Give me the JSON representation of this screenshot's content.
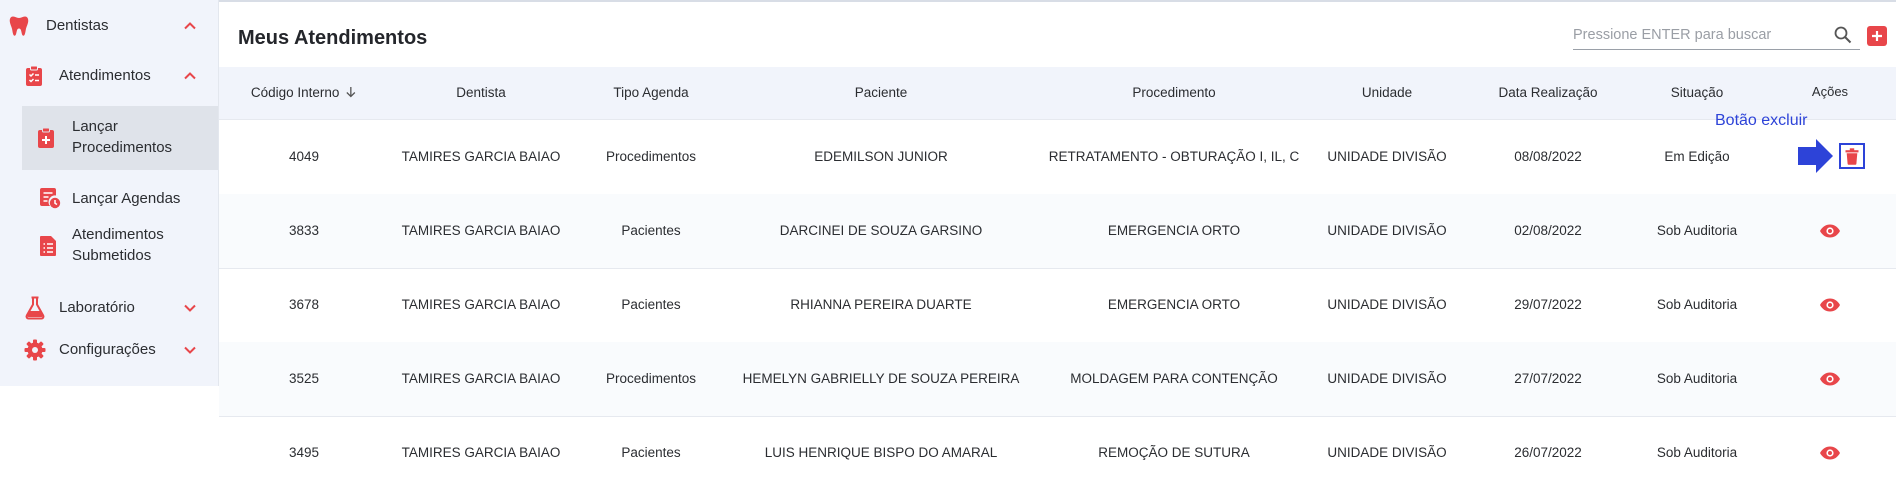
{
  "sidebar": {
    "items": [
      {
        "label": "Dentistas",
        "icon": "tooth-icon"
      },
      {
        "label": "Atendimentos",
        "icon": "clipboard-check-icon"
      },
      {
        "label": "Lançar Procedimentos",
        "icon": "clipboard-plus-icon",
        "selected": true
      },
      {
        "label": "Lançar Agendas",
        "icon": "calendar-clock-icon"
      },
      {
        "label": "Atendimentos Submetidos",
        "icon": "document-list-icon"
      },
      {
        "label": "Laboratório",
        "icon": "flask-icon"
      },
      {
        "label": "Configurações",
        "icon": "gear-icon"
      }
    ]
  },
  "header": {
    "title": "Meus Atendimentos",
    "search_placeholder": "Pressione ENTER para buscar"
  },
  "table": {
    "columns": [
      "Código Interno",
      "Dentista",
      "Tipo Agenda",
      "Paciente",
      "Procedimento",
      "Unidade",
      "Data Realização",
      "Situação",
      "Ações"
    ],
    "sort_column": "Código Interno",
    "rows": [
      {
        "codigo": "4049",
        "dentista": "TAMIRES GARCIA BAIAO",
        "tipo": "Procedimentos",
        "paciente": "EDEMILSON JUNIOR",
        "procedimento": "RETRATAMENTO - OBTURAÇÃO I, IL, C",
        "unidade": "UNIDADE DIVISÃO",
        "data": "08/08/2022",
        "situacao": "Em Edição",
        "acao": "delete-icon"
      },
      {
        "codigo": "3833",
        "dentista": "TAMIRES GARCIA BAIAO",
        "tipo": "Pacientes",
        "paciente": "DARCINEI DE SOUZA GARSINO",
        "procedimento": "EMERGENCIA ORTO",
        "unidade": "UNIDADE DIVISÃO",
        "data": "02/08/2022",
        "situacao": "Sob Auditoria",
        "acao": "eye-icon"
      },
      {
        "codigo": "3678",
        "dentista": "TAMIRES GARCIA BAIAO",
        "tipo": "Pacientes",
        "paciente": "RHIANNA PEREIRA DUARTE",
        "procedimento": "EMERGENCIA ORTO",
        "unidade": "UNIDADE DIVISÃO",
        "data": "29/07/2022",
        "situacao": "Sob Auditoria",
        "acao": "eye-icon"
      },
      {
        "codigo": "3525",
        "dentista": "TAMIRES GARCIA BAIAO",
        "tipo": "Procedimentos",
        "paciente": "HEMELYN GABRIELLY DE SOUZA PEREIRA",
        "procedimento": "MOLDAGEM PARA CONTENÇÃO",
        "unidade": "UNIDADE DIVISÃO",
        "data": "27/07/2022",
        "situacao": "Sob Auditoria",
        "acao": "eye-icon"
      },
      {
        "codigo": "3495",
        "dentista": "TAMIRES GARCIA BAIAO",
        "tipo": "Pacientes",
        "paciente": "LUIS HENRIQUE BISPO DO AMARAL",
        "procedimento": "REMOÇÃO DE SUTURA",
        "unidade": "UNIDADE DIVISÃO",
        "data": "26/07/2022",
        "situacao": "Sob Auditoria",
        "acao": "eye-icon"
      }
    ]
  },
  "annotation": {
    "label": "Botão excluir"
  },
  "colors": {
    "accent": "#e8464a",
    "sidebar_bg": "#f1f4fb",
    "selected_bg": "#dfe3ea",
    "annotation": "#2d43d8"
  }
}
